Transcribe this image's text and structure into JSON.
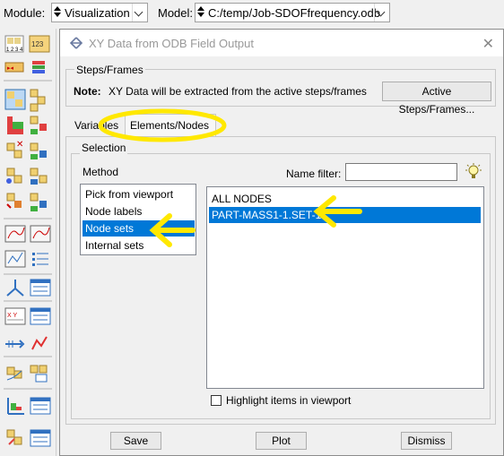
{
  "topbar": {
    "module_label": "Module:",
    "module_value": "Visualization",
    "model_label": "Model:",
    "model_value": "C:/temp/Job-SDOFfrequency.odb"
  },
  "toolbox": {
    "icons": [
      "query-numbers-icon",
      "numbering-icon",
      "layers-icon",
      "contour-icon",
      "field-output-icon",
      "plot-deformed-icon",
      "plot-contour-icon",
      "symbol-icon",
      "material-orientation-icon",
      "animate-icon",
      "animate-time-icon",
      "xy-plot-icon",
      "xy-data-manager-icon",
      "path-icon",
      "create-xy-data-icon",
      "free-body-icon",
      "display-group-icon",
      "table-icon",
      "stress-linearize-icon",
      "report-icon",
      "xy-chart-icon",
      "probe-icon",
      "view-cut-icon",
      "display-options-icon",
      "color-code-icon",
      "render-icon"
    ]
  },
  "dialog": {
    "title": "XY Data from ODB Field Output",
    "steps_frames_label": "Steps/Frames",
    "note_label": "Note:",
    "note_text": "XY Data will be extracted from the active steps/frames",
    "active_steps_button": "Active Steps/Frames...",
    "tabs": [
      {
        "label": "Variables",
        "active": false
      },
      {
        "label": "Elements/Nodes",
        "active": true
      }
    ],
    "selection_label": "Selection",
    "method_label": "Method",
    "methods": [
      {
        "label": "Pick from viewport",
        "selected": false
      },
      {
        "label": "Node labels",
        "selected": false
      },
      {
        "label": "Node sets",
        "selected": true
      },
      {
        "label": "Internal sets",
        "selected": false
      }
    ],
    "name_filter_label": "Name filter:",
    "name_filter_value": "",
    "sets": [
      {
        "label": "ALL NODES",
        "selected": false
      },
      {
        "label": "PART-MASS1-1.SET-1",
        "selected": true
      }
    ],
    "highlight_label": "Highlight items in viewport",
    "highlight_checked": false,
    "buttons": {
      "save": "Save",
      "plot": "Plot",
      "dismiss": "Dismiss"
    }
  },
  "colors": {
    "selection": "#0078d7",
    "annotation": "#ffe800"
  }
}
